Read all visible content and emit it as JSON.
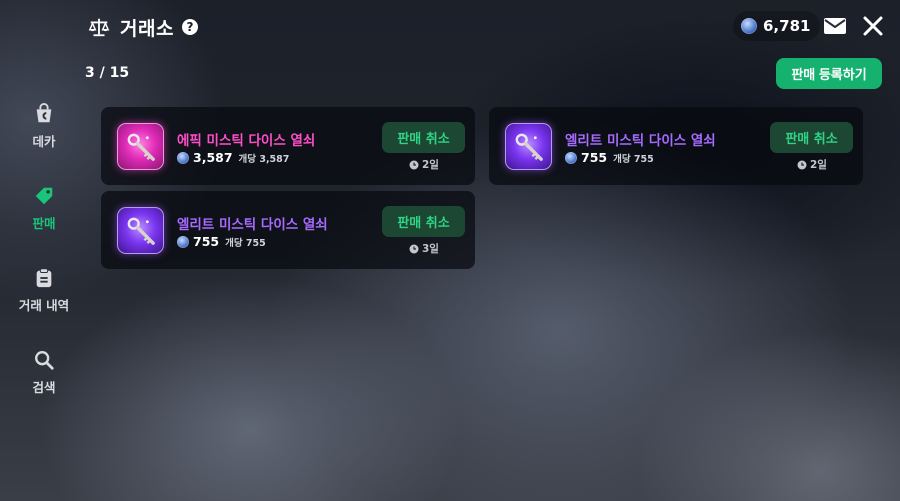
{
  "header": {
    "title": "거래소",
    "help": "?",
    "currency_amount": "6,781"
  },
  "page_count": "3 / 15",
  "register_button": "판매 등록하기",
  "sidebar": {
    "items": [
      {
        "label": "데카",
        "icon": "bag-icon",
        "active": false
      },
      {
        "label": "판매",
        "icon": "tag-icon",
        "active": true
      },
      {
        "label": "거래 내역",
        "icon": "clipboard-icon",
        "active": false
      },
      {
        "label": "검색",
        "icon": "search-icon",
        "active": false
      }
    ]
  },
  "listings": [
    {
      "name": "에픽 미스틱 다이스 열쇠",
      "grade": "epic",
      "price": "3,587",
      "unit_price": "개당 3,587",
      "cancel_label": "판매 취소",
      "time_left": "2일"
    },
    {
      "name": "엘리트 미스틱 다이스 열쇠",
      "grade": "elite",
      "price": "755",
      "unit_price": "개당 755",
      "cancel_label": "판매 취소",
      "time_left": "2일"
    },
    {
      "name": "엘리트 미스틱 다이스 열쇠",
      "grade": "elite",
      "price": "755",
      "unit_price": "개당 755",
      "cancel_label": "판매 취소",
      "time_left": "3일"
    }
  ],
  "colors": {
    "accent_green": "#14b26e",
    "epic": "#ff4fc8",
    "elite": "#a66bff"
  }
}
